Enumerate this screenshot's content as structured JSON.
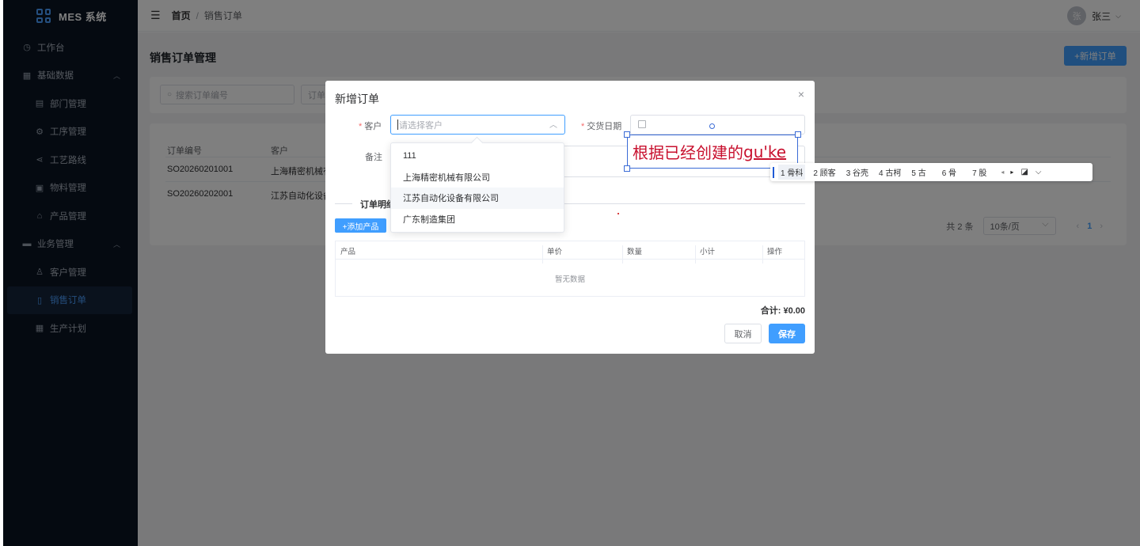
{
  "sidebar": {
    "logo_text": "MES 系统",
    "items": [
      {
        "label": "工作台",
        "icon": "dashboard-icon"
      },
      {
        "label": "基础数据",
        "icon": "grid-icon",
        "expanded": true
      },
      {
        "label": "部门管理",
        "icon": "building-icon"
      },
      {
        "label": "工序管理",
        "icon": "gear-icon"
      },
      {
        "label": "工艺路线",
        "icon": "share-icon"
      },
      {
        "label": "物料管理",
        "icon": "package-icon"
      },
      {
        "label": "产品管理",
        "icon": "bag-icon"
      },
      {
        "label": "业务管理",
        "icon": "briefcase-icon",
        "expanded": true
      },
      {
        "label": "客户管理",
        "icon": "user-icon"
      },
      {
        "label": "销售订单",
        "icon": "document-icon",
        "active": true
      },
      {
        "label": "生产计划",
        "icon": "calendar-icon"
      }
    ]
  },
  "topbar": {
    "breadcrumb_home": "首页",
    "breadcrumb_sep": "/",
    "breadcrumb_current": "销售订单",
    "avatar_text": "张",
    "user_name": "张三"
  },
  "page": {
    "title": "销售订单管理",
    "new_order_button": "+新增订单",
    "search_placeholder": "搜索订单编号",
    "search2_placeholder": "订单"
  },
  "table": {
    "columns": [
      "订单编号",
      "客户"
    ],
    "rows": [
      {
        "order_no": "SO20260201001",
        "customer": "上海精密机械有"
      },
      {
        "order_no": "SO20260202001",
        "customer": "江苏自动化设备"
      }
    ]
  },
  "pagination": {
    "total": "共 2 条",
    "page_size": "10条/页",
    "prev": "‹",
    "current": "1",
    "next": "›"
  },
  "dialog": {
    "title": "新增订单",
    "close": "×",
    "customer_label": "客户",
    "customer_placeholder": "请选择客户",
    "delivery_label": "交货日期",
    "remark_label": "备注",
    "section_title": "订单明细",
    "add_product_button": "+添加产品",
    "detail_columns": [
      "产品",
      "单价",
      "数量",
      "小计",
      "操作"
    ],
    "empty_text": "暂无数据",
    "total_text": "合计: ¥0.00",
    "cancel_button": "取消",
    "save_button": "保存"
  },
  "customer_dropdown": {
    "options": [
      "111",
      "上海精密机械有限公司",
      "江苏自动化设备有限公司",
      "广东制造集团"
    ],
    "hovered_index": 2
  },
  "ime": {
    "composition_text": "根据已经创建的",
    "composition_pinyin": "gu'ke",
    "candidates": [
      "1 骨科",
      "2 顾客",
      "3 谷壳",
      "4 古柯",
      "5 古",
      "6 骨",
      "7 股"
    ],
    "prev": "◂",
    "next": "▸",
    "more": "⌵"
  },
  "colors": {
    "sidebar_bg": "#0b1423",
    "primary": "#409eff",
    "required": "#f56c6c",
    "ime_text": "#c8102e"
  }
}
